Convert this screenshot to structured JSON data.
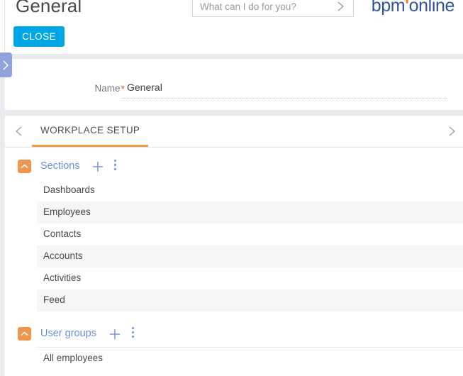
{
  "header": {
    "page_title": "General",
    "search": {
      "placeholder": "What can I do for you?",
      "value": "",
      "submit_icon": "chevron-right-icon"
    },
    "logo": {
      "part1": "bpm",
      "apostrophe": "'",
      "part2": "online",
      "color": "#2f5596",
      "accent_color": "#ef8022"
    },
    "close_button": {
      "label": "CLOSE",
      "color": "#00a7e7"
    }
  },
  "side_panel_toggle": {
    "icon": "chevron-right-icon",
    "color": "#8fa3dc"
  },
  "form": {
    "name_field": {
      "label": "Name",
      "required_marker": "*",
      "value": "General"
    }
  },
  "tabstrip": {
    "prev_icon": "chevron-left-icon",
    "next_icon": "chevron-right-icon",
    "active_indicator_color": "#f2994a",
    "tabs": [
      {
        "label": "WORKPLACE SETUP",
        "active": true
      }
    ]
  },
  "groups": [
    {
      "title": "Sections",
      "collapse_icon": "chevron-up-icon",
      "collapse_icon_color": "#f0954d",
      "add_icon": "plus-icon",
      "menu_icon": "kebab-menu-icon",
      "bordered": false,
      "rows": [
        {
          "label": "Dashboards"
        },
        {
          "label": "Employees"
        },
        {
          "label": "Contacts"
        },
        {
          "label": "Accounts"
        },
        {
          "label": "Activities"
        },
        {
          "label": "Feed"
        }
      ]
    },
    {
      "title": "User groups",
      "collapse_icon": "chevron-up-icon",
      "collapse_icon_color": "#f0954d",
      "add_icon": "plus-icon",
      "menu_icon": "kebab-menu-icon",
      "bordered": true,
      "rows": [
        {
          "label": "All employees"
        }
      ]
    }
  ]
}
